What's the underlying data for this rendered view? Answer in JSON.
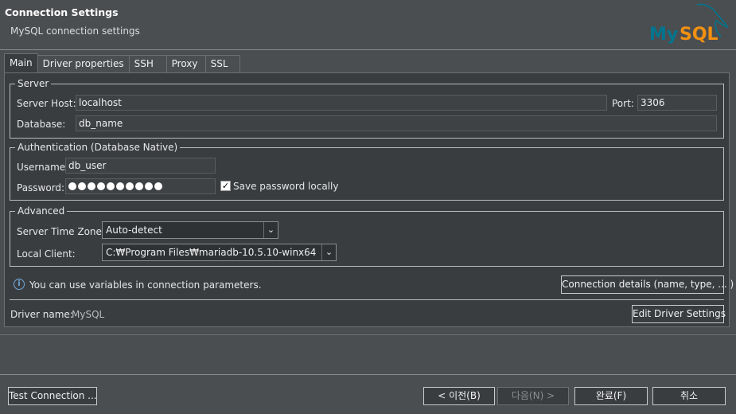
{
  "header": {
    "title": "Connection Settings",
    "subtitle": "MySQL connection settings",
    "logo_text": "MySQL"
  },
  "tabs": [
    "Main",
    "Driver properties",
    "SSH",
    "Proxy",
    "SSL"
  ],
  "server": {
    "legend": "Server",
    "host_label": "Server Host:",
    "host_value": "localhost",
    "port_label": "Port:",
    "port_value": "3306",
    "database_label": "Database:",
    "database_value": "db_name"
  },
  "auth": {
    "legend": "Authentication (Database Native)",
    "username_label": "Username:",
    "username_value": "db_user",
    "password_label": "Password:",
    "password_length": 10,
    "save_password_label": "Save password locally",
    "save_password_checked": true
  },
  "advanced": {
    "legend": "Advanced",
    "timezone_label": "Server Time Zone:",
    "timezone_value": "Auto-detect",
    "client_label": "Local Client:",
    "client_value": "C:₩Program Files₩mariadb-10.5.10-winx64"
  },
  "info": {
    "text": "You can use variables in connection parameters.",
    "details_button": "Connection details (name, type, ... )"
  },
  "driver": {
    "label": "Driver name:",
    "value": "MySQL",
    "edit_button": "Edit Driver Settings"
  },
  "footer": {
    "test_button": "Test Connection ...",
    "back_button": "< 이전(B)",
    "next_button": "다음(N) >",
    "finish_button": "완료(F)",
    "cancel_button": "취소"
  },
  "colors": {
    "background": "#4b4e51",
    "panel": "#3a3d40",
    "logo_blue": "#00758f",
    "logo_orange": "#f29111"
  }
}
